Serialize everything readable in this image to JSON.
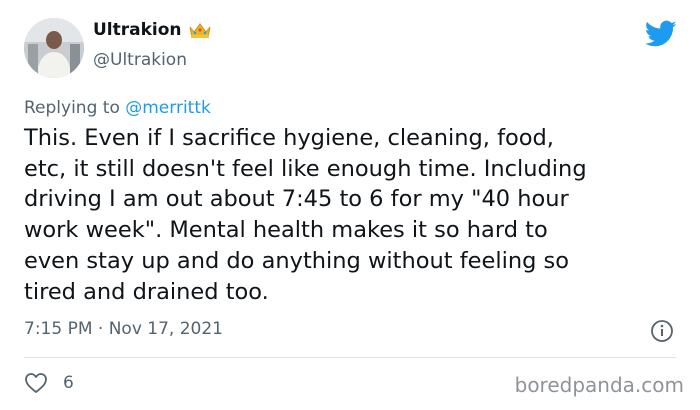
{
  "user": {
    "display_name": "Ultrakion",
    "handle": "@Ultrakion",
    "badge_icon": "crown-icon",
    "verified_badge_color": "#e8b923"
  },
  "reply": {
    "prefix": "Replying to",
    "mention": "@merrittk"
  },
  "tweet": {
    "text": "This. Even if I sacrifice hygiene, cleaning, food,\netc, it still doesn't feel like enough time. Including\ndriving I am out about 7:45 to 6 for my \"40 hour\nwork week\". Mental health makes it so hard to\neven stay up and do anything without feeling so\ntired and drained too.",
    "timestamp": "7:15 PM · Nov 17, 2021",
    "likes": "6"
  },
  "icons": {
    "brand": "twitter-bird-icon",
    "info": "info-icon",
    "like": "heart-icon"
  },
  "colors": {
    "twitter_blue": "#1d9bf0",
    "text_primary": "#0f1419",
    "text_secondary": "#536471"
  },
  "watermark": "boredpanda.com"
}
